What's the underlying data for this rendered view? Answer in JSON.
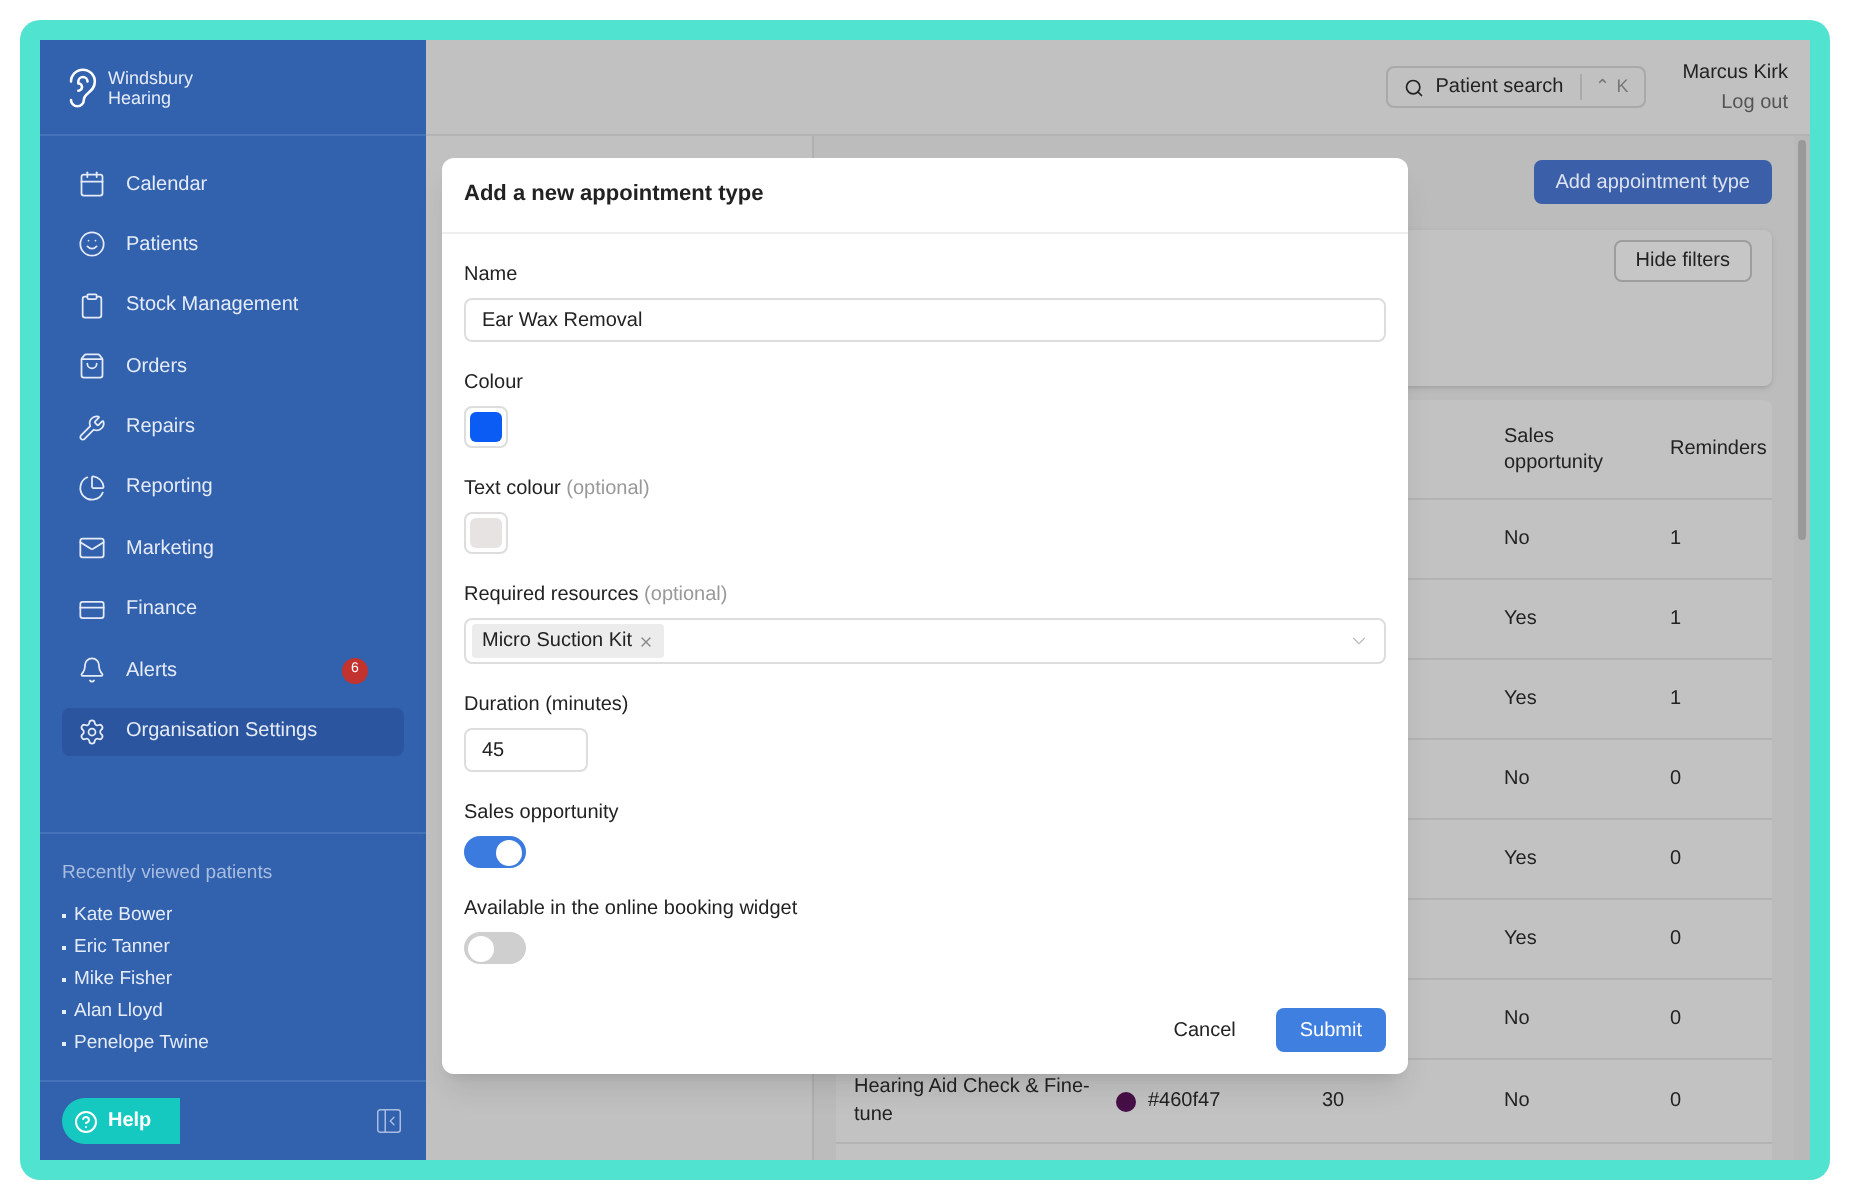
{
  "brand": {
    "line1": "Windsbury",
    "line2": "Hearing"
  },
  "nav": [
    {
      "label": "Calendar",
      "selected": false
    },
    {
      "label": "Patients",
      "selected": false
    },
    {
      "label": "Stock Management",
      "selected": false
    },
    {
      "label": "Orders",
      "selected": false
    },
    {
      "label": "Repairs",
      "selected": false
    },
    {
      "label": "Reporting",
      "selected": false
    },
    {
      "label": "Marketing",
      "selected": false
    },
    {
      "label": "Finance",
      "selected": false
    },
    {
      "label": "Alerts",
      "selected": false,
      "badge": "6"
    },
    {
      "label": "Organisation Settings",
      "selected": true
    }
  ],
  "recent": {
    "title": "Recently viewed patients",
    "patients": [
      "Kate Bower",
      "Eric Tanner",
      "Mike Fisher",
      "Alan Lloyd",
      "Penelope Twine"
    ]
  },
  "help": "Help",
  "header": {
    "search": {
      "label": "Patient search",
      "shortcut": "⌃ K"
    },
    "user": "Marcus Kirk",
    "logout": "Log out"
  },
  "toolbar": {
    "add_button": "Add appointment type",
    "hide_filters": "Hide filters"
  },
  "table": {
    "columns": [
      {
        "label": "Sales opportunity"
      },
      {
        "label": "Reminders"
      }
    ],
    "rows": [
      {
        "sales": "No",
        "reminders": "1"
      },
      {
        "sales": "Yes",
        "reminders": "1"
      },
      {
        "sales": "Yes",
        "reminders": "1"
      },
      {
        "sales": "No",
        "reminders": "0"
      },
      {
        "sales": "Yes",
        "reminders": "0"
      },
      {
        "sales": "Yes",
        "reminders": "0"
      },
      {
        "sales": "No",
        "reminders": "0"
      },
      {
        "name": "Hearing Aid Check & Fine-tune",
        "color": "#460f47",
        "hex": "#460f47",
        "duration": "30",
        "sales": "No",
        "reminders": "0"
      }
    ]
  },
  "modal": {
    "title": "Add a new appointment type",
    "fields": [
      {
        "kind": "text",
        "label": "Name",
        "value": "Ear Wax Removal"
      },
      {
        "kind": "color",
        "label": "Colour",
        "color": "#0a5cf5"
      },
      {
        "kind": "color",
        "label": "Text colour",
        "hint": "(optional)",
        "color": "#e8e3e3"
      },
      {
        "kind": "tags",
        "label": "Required resources",
        "hint": "(optional)",
        "tags": [
          "Micro Suction Kit"
        ]
      },
      {
        "kind": "number",
        "label": "Duration (minutes)",
        "value": "45"
      },
      {
        "kind": "toggle",
        "label": "Sales opportunity",
        "on": true
      },
      {
        "kind": "toggle",
        "label": "Available in the online booking widget",
        "on": false
      }
    ],
    "cancel": "Cancel",
    "submit": "Submit"
  }
}
